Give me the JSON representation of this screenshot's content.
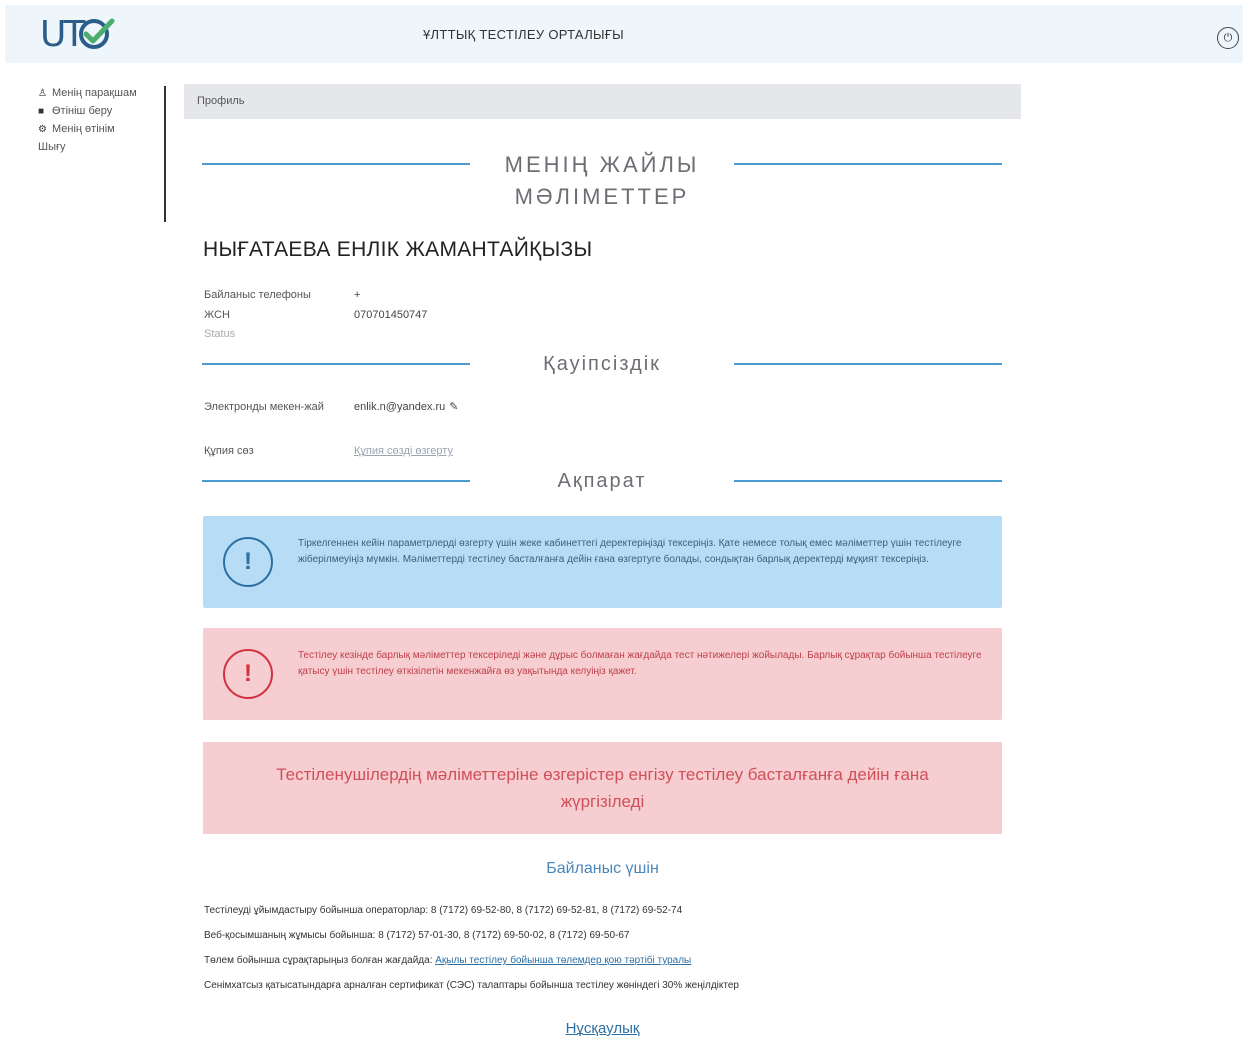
{
  "header": {
    "logo_text": "UT",
    "site_title": "ҰЛТТЫҚ ТЕСТІЛЕУ ОРТАЛЫҒЫ",
    "brand_color": "#2b5d8a",
    "accent_color": "#4cae6e"
  },
  "sidebar": {
    "items": [
      {
        "icon": "user-icon",
        "glyph": "♙",
        "label": "Менің парақшам"
      },
      {
        "icon": "document-icon",
        "glyph": "■",
        "label": "Өтініш беру"
      },
      {
        "icon": "gear-icon",
        "glyph": "⚙",
        "label": "Менің өтінім"
      },
      {
        "icon": "none",
        "glyph": "",
        "label": "Шығу"
      }
    ]
  },
  "breadcrumb": "Профиль",
  "sections": {
    "personal": "МЕНІҢ ЖАЙЛЫ МӘЛІМЕТТЕР",
    "security": "Қауіпсіздік",
    "info": "Ақпарат"
  },
  "profile": {
    "full_name": "НЫҒАТАЕВА ЕНЛІК ЖАМАНТАЙҚЫЗЫ",
    "phone_label": "Байланыс телефоны",
    "phone_value": "+",
    "iin_label": "ЖСН",
    "iin_value": "070701450747",
    "status_label": "Status"
  },
  "security": {
    "email_label": "Электронды мекен-жай",
    "email_value": "enlik.n@yandex.ru",
    "password_label": "Құпия сөз",
    "password_link": "Құпия сөзді өзгерту"
  },
  "alerts": {
    "blue": "Тіркелгеннен кейін параметрлерді өзгерту үшін жеке кабинеттегі деректеріңізді тексеріңіз. Қате немесе толық емес мәліметтер үшін тестілеуге жіберілмеуіңіз мүмкін. Мәліметтерді тестілеу басталғанға дейін ғана өзгертуге болады, сондықтан барлық деректерді мұқият тексеріңіз.",
    "red": "Тестілеу кезінде барлық мәліметтер тексеріледі және дұрыс болмаған жағдайда тест нәтижелері жойылады. Барлық сұрақтар бойынша тестілеуге қатысу үшін тестілеу өткізілетін мекенжайға өз уақытында келуіңіз қажет.",
    "big": "Тестіленушілердің мәліметтеріне өзгерістер енгізу тестілеу басталғанға дейін ғана жүргізіледі"
  },
  "contacts": {
    "title": "Байланыс үшін",
    "line1": "Тестілеуді ұйымдастыру бойынша операторлар: 8 (7172) 69-52-80, 8 (7172) 69-52-81, 8 (7172) 69-52-74",
    "line2": "Веб-қосымшаның жұмысы бойынша: 8 (7172) 57-01-30, 8 (7172) 69-50-02, 8 (7172) 69-50-67",
    "line3_prefix": "Төлем бойынша сұрақтарыңыз болған жағдайда: ",
    "line3_link": "Ақылы тестілеу бойынша төлемдер қою тәртібі туралы",
    "line4": "Сенімхатсыз қатысатындарға арналған сертификат (СЭС) талаптары бойынша тестілеу жөніндегі 30% жеңілдіктер"
  },
  "footer_link": "Нұсқаулық"
}
